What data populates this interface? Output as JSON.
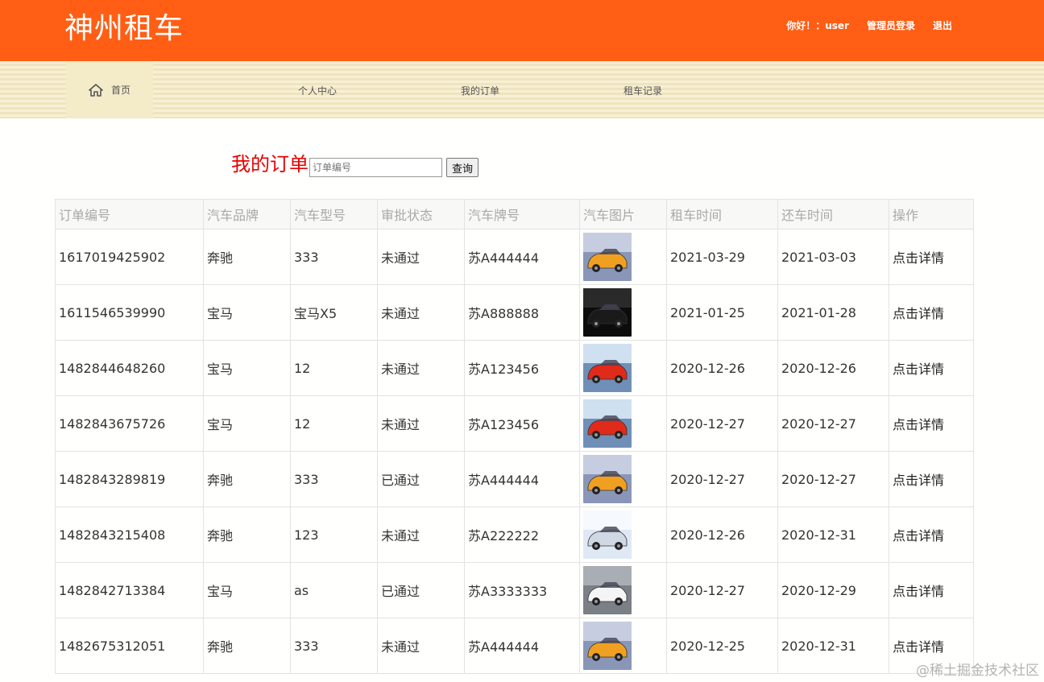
{
  "header": {
    "brand": "神州租车",
    "greeting": "你好！：user",
    "admin_login": "管理员登录",
    "logout": "退出"
  },
  "nav": {
    "home": "首页",
    "profile": "个人中心",
    "my_orders": "我的订单",
    "rental_records": "租车记录"
  },
  "search": {
    "title": "我的订单",
    "placeholder": "订单编号",
    "button": "查询"
  },
  "table": {
    "headers": [
      "订单编号",
      "汽车品牌",
      "汽车型号",
      "审批状态",
      "汽车牌号",
      "汽车图片",
      "租车时间",
      "还车时间",
      "操作"
    ],
    "rows": [
      {
        "id": "1617019425902",
        "brand": "奔驰",
        "model": "333",
        "status": "未通过",
        "plate": "苏A444444",
        "image": "orange-car",
        "start": "2021-03-29",
        "end": "2021-03-03",
        "action": "点击详情"
      },
      {
        "id": "1611546539990",
        "brand": "宝马",
        "model": "宝马X5",
        "status": "未通过",
        "plate": "苏A888888",
        "image": "black-car",
        "start": "2021-01-25",
        "end": "2021-01-28",
        "action": "点击详情"
      },
      {
        "id": "1482844648260",
        "brand": "宝马",
        "model": "12",
        "status": "未通过",
        "plate": "苏A123456",
        "image": "red-car",
        "start": "2020-12-26",
        "end": "2020-12-26",
        "action": "点击详情"
      },
      {
        "id": "1482843675726",
        "brand": "宝马",
        "model": "12",
        "status": "未通过",
        "plate": "苏A123456",
        "image": "red-car",
        "start": "2020-12-27",
        "end": "2020-12-27",
        "action": "点击详情"
      },
      {
        "id": "1482843289819",
        "brand": "奔驰",
        "model": "333",
        "status": "已通过",
        "plate": "苏A444444",
        "image": "orange-car",
        "start": "2020-12-27",
        "end": "2020-12-27",
        "action": "点击详情"
      },
      {
        "id": "1482843215408",
        "brand": "奔驰",
        "model": "123",
        "status": "未通过",
        "plate": "苏A222222",
        "image": "silver-car",
        "start": "2020-12-26",
        "end": "2020-12-31",
        "action": "点击详情"
      },
      {
        "id": "1482842713384",
        "brand": "宝马",
        "model": "as",
        "status": "已通过",
        "plate": "苏A3333333",
        "image": "white-car",
        "start": "2020-12-27",
        "end": "2020-12-29",
        "action": "点击详情"
      },
      {
        "id": "1482675312051",
        "brand": "奔驰",
        "model": "333",
        "status": "未通过",
        "plate": "苏A444444",
        "image": "orange-car",
        "start": "2020-12-25",
        "end": "2020-12-31",
        "action": "点击详情"
      }
    ]
  },
  "watermark": "@稀土掘金技术社区",
  "colors": {
    "header_bg": "#ff5e14",
    "title_red": "#e60000",
    "car_orange": "#f0a020",
    "car_black": "#1a1a1a",
    "car_red": "#e02a1a",
    "car_silver": "#cfd8e3",
    "car_white": "#f4f4f4"
  }
}
